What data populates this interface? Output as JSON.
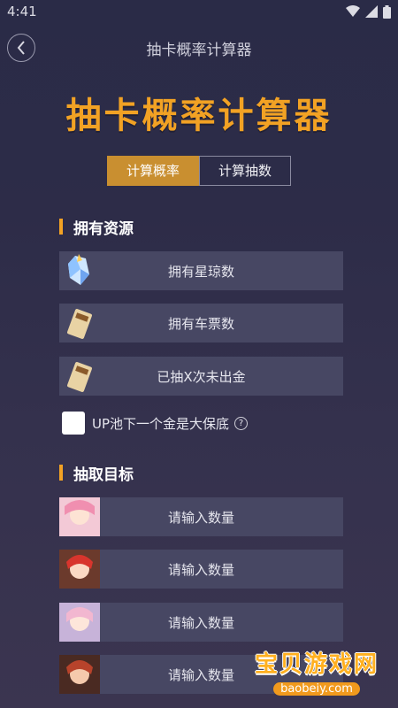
{
  "status_bar": {
    "time": "4:41"
  },
  "header": {
    "title": "抽卡概率计算器"
  },
  "hero": {
    "title": "抽卡概率计算器"
  },
  "tabs": [
    {
      "label": "计算概率",
      "active": true
    },
    {
      "label": "计算抽数",
      "active": false
    }
  ],
  "resources": {
    "section_title": "拥有资源",
    "rows": [
      {
        "label": "拥有星琼数",
        "icon": "crystal-icon"
      },
      {
        "label": "拥有车票数",
        "icon": "ticket-icon"
      },
      {
        "label": "已抽X次未出金",
        "icon": "ticket-icon"
      }
    ],
    "checkbox_label": "UP池下一个金是大保底",
    "help_symbol": "?"
  },
  "targets": {
    "section_title": "抽取目标",
    "rows": [
      {
        "label": "请输入数量",
        "icon": "character-portrait-icon"
      },
      {
        "label": "请输入数量",
        "icon": "character-portrait-icon"
      },
      {
        "label": "请输入数量",
        "icon": "character-portrait-icon"
      },
      {
        "label": "请输入数量",
        "icon": "character-portrait-icon"
      }
    ]
  },
  "watermark": {
    "title": "宝贝游戏网",
    "url": "baobeiy.com"
  },
  "colors": {
    "accent": "#f2a224",
    "tab_active": "#c98f30",
    "row_bg": "#474763"
  }
}
